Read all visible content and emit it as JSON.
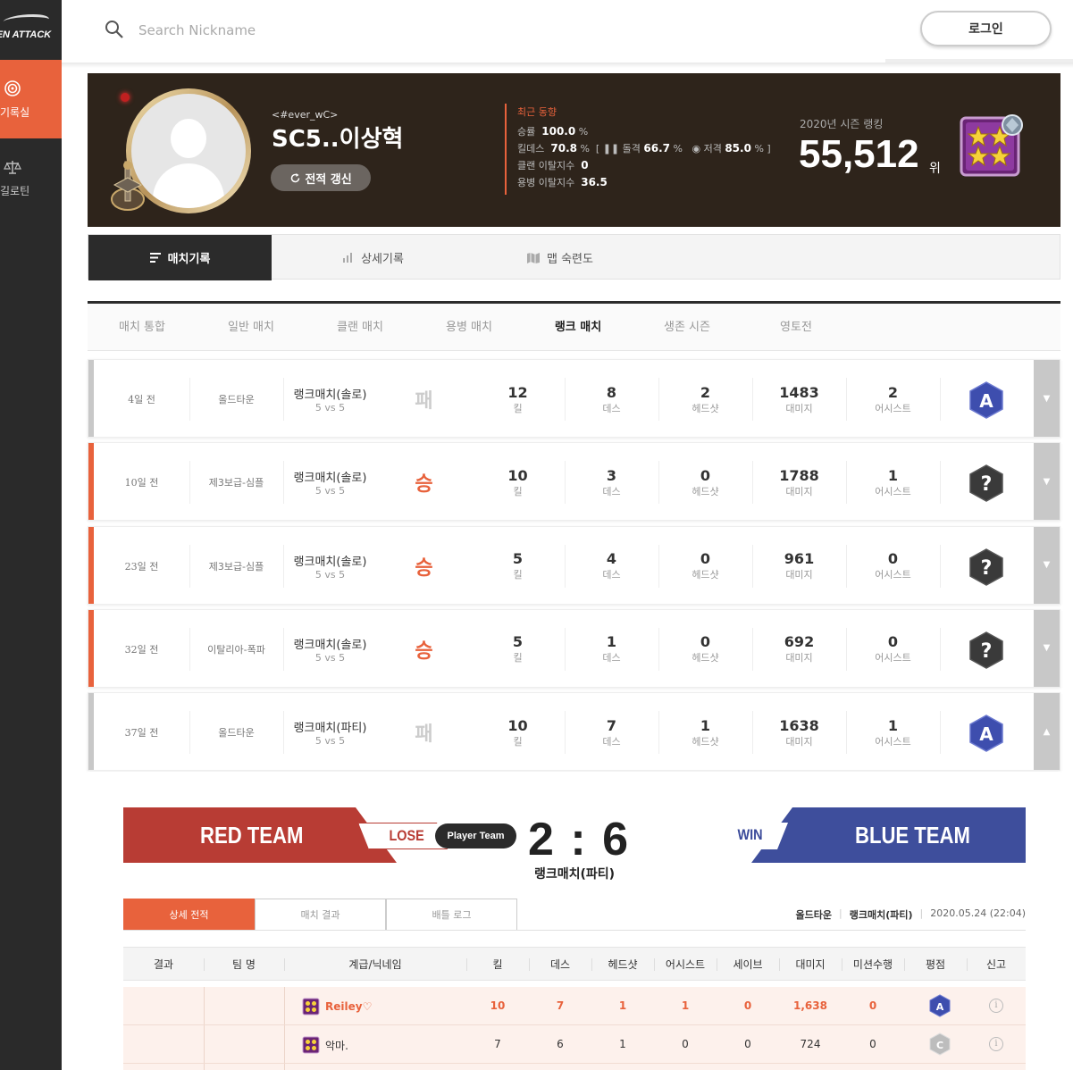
{
  "app": {
    "logo_text": "REN ATTACK"
  },
  "sidebar": {
    "items": [
      {
        "label": "기록실",
        "active": true,
        "icon": "target-icon"
      },
      {
        "label": "길로틴",
        "active": false,
        "icon": "scale-icon"
      }
    ]
  },
  "search": {
    "placeholder": "Search Nickname"
  },
  "header": {
    "login_label": "로그인"
  },
  "profile": {
    "clan": "<#ever_wC>",
    "nickname": "SC5..이상혁",
    "refresh_label": "전적 갱신",
    "recent": {
      "title": "최근 동향",
      "win_rate_label": "승률",
      "win_rate": "100.0",
      "kd_label": "킬데스",
      "kd": "70.8",
      "assault_label": "돌격",
      "assault": "66.7",
      "sniper_label": "저격",
      "sniper": "85.0",
      "clan_leave_label": "클랜 이탈지수",
      "clan_leave": "0",
      "merc_leave_label": "용병 이탈지수",
      "merc_leave": "36.5",
      "pct": "%"
    },
    "season_label": "2020년 시즌 랭킹",
    "rank": "55,512",
    "rank_unit": "위"
  },
  "tabs": [
    {
      "label": "매치기록",
      "icon": "list-icon",
      "active": true
    },
    {
      "label": "상세기록",
      "icon": "bar-chart-icon",
      "active": false
    },
    {
      "label": "맵 숙련도",
      "icon": "map-icon",
      "active": false
    }
  ],
  "subtabs": [
    {
      "label": "매치 통합"
    },
    {
      "label": "일반 매치"
    },
    {
      "label": "클랜 매치"
    },
    {
      "label": "용병 매치"
    },
    {
      "label": "랭크 매치",
      "active": true
    },
    {
      "label": "생존 시즌"
    },
    {
      "label": "영토전"
    }
  ],
  "stat_labels": {
    "kill": "킬",
    "death": "데스",
    "headshot": "헤드샷",
    "damage": "대미지",
    "assist": "어시스트"
  },
  "matches": [
    {
      "days": "4일 전",
      "map": "올드타운",
      "mode": "랭크매치(솔로)",
      "size": "5 vs 5",
      "result": "패",
      "win": false,
      "kill": "12",
      "death": "8",
      "headshot": "2",
      "damage": "1483",
      "assist": "2",
      "grade": "A",
      "arrow": "▼"
    },
    {
      "days": "10일 전",
      "map": "제3보급-심플",
      "mode": "랭크매치(솔로)",
      "size": "5 vs 5",
      "result": "승",
      "win": true,
      "kill": "10",
      "death": "3",
      "headshot": "0",
      "damage": "1788",
      "assist": "1",
      "grade": "?",
      "arrow": "▼"
    },
    {
      "days": "23일 전",
      "map": "제3보급-심플",
      "mode": "랭크매치(솔로)",
      "size": "5 vs 5",
      "result": "승",
      "win": true,
      "kill": "5",
      "death": "4",
      "headshot": "0",
      "damage": "961",
      "assist": "0",
      "grade": "?",
      "arrow": "▼"
    },
    {
      "days": "32일 전",
      "map": "이탈리아-폭파",
      "mode": "랭크매치(솔로)",
      "size": "5 vs 5",
      "result": "승",
      "win": true,
      "kill": "5",
      "death": "1",
      "headshot": "0",
      "damage": "692",
      "assist": "0",
      "grade": "?",
      "arrow": "▼"
    },
    {
      "days": "37일 전",
      "map": "올드타운",
      "mode": "랭크매치(파티)",
      "size": "5 vs 5",
      "result": "패",
      "win": false,
      "kill": "10",
      "death": "7",
      "headshot": "1",
      "damage": "1638",
      "assist": "1",
      "grade": "A",
      "arrow": "▲"
    }
  ],
  "detail": {
    "red_team": "RED TEAM",
    "blue_team": "BLUE TEAM",
    "lose": "LOSE",
    "win": "WIN",
    "player_team": "Player Team",
    "score": "2 : 6",
    "mode": "랭크매치(파티)",
    "tabs": [
      "상세 전적",
      "매치 결과",
      "배틀 로그"
    ],
    "map": "올드타운",
    "mode_small": "랭크매치(파티)",
    "date": "2020.05.24 (22:04)",
    "headers": [
      "결과",
      "팀 명",
      "계급/닉네임",
      "킬",
      "데스",
      "헤드샷",
      "어시스트",
      "세이브",
      "대미지",
      "미션수행",
      "평점",
      "신고"
    ],
    "players": [
      {
        "name": "Reiley♡",
        "kill": "10",
        "death": "7",
        "headshot": "1",
        "assist": "1",
        "save": "0",
        "damage": "1,638",
        "mission": "0",
        "grade": "A",
        "me": true
      },
      {
        "name": "악마.",
        "kill": "7",
        "death": "6",
        "headshot": "1",
        "assist": "0",
        "save": "0",
        "damage": "724",
        "mission": "0",
        "grade": "C",
        "me": false
      }
    ],
    "info_glyph": "i"
  },
  "colors": {
    "accent": "#e8623c",
    "red_team": "#b83c34",
    "blue_team": "#3e4e9c",
    "profile_bg": "#2e241b",
    "grade_a": "#3e4eae",
    "grade_unknown": "#3a3a3a"
  }
}
